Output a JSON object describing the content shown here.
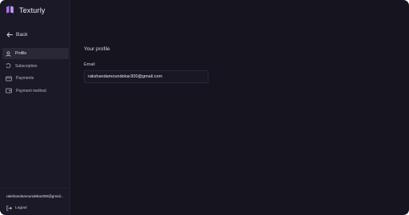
{
  "app": {
    "name": "Texturly",
    "accent": "#a96ee8"
  },
  "nav": {
    "back_label": "Back",
    "items": [
      {
        "label": "Profile",
        "icon": "user-icon",
        "active": true
      },
      {
        "label": "Subscription",
        "icon": "subscription-icon",
        "active": false
      },
      {
        "label": "Payments",
        "icon": "payments-icon",
        "active": false
      },
      {
        "label": "Payment method",
        "icon": "payment-method-icon",
        "active": false
      }
    ]
  },
  "user": {
    "email_truncated": "rakshandamoundekar300@gmail...",
    "logout_label": "Logout"
  },
  "profile": {
    "section_title": "Your profile",
    "email_label": "Email",
    "email_value": "rakshandamoundekar300@gmail.com"
  }
}
